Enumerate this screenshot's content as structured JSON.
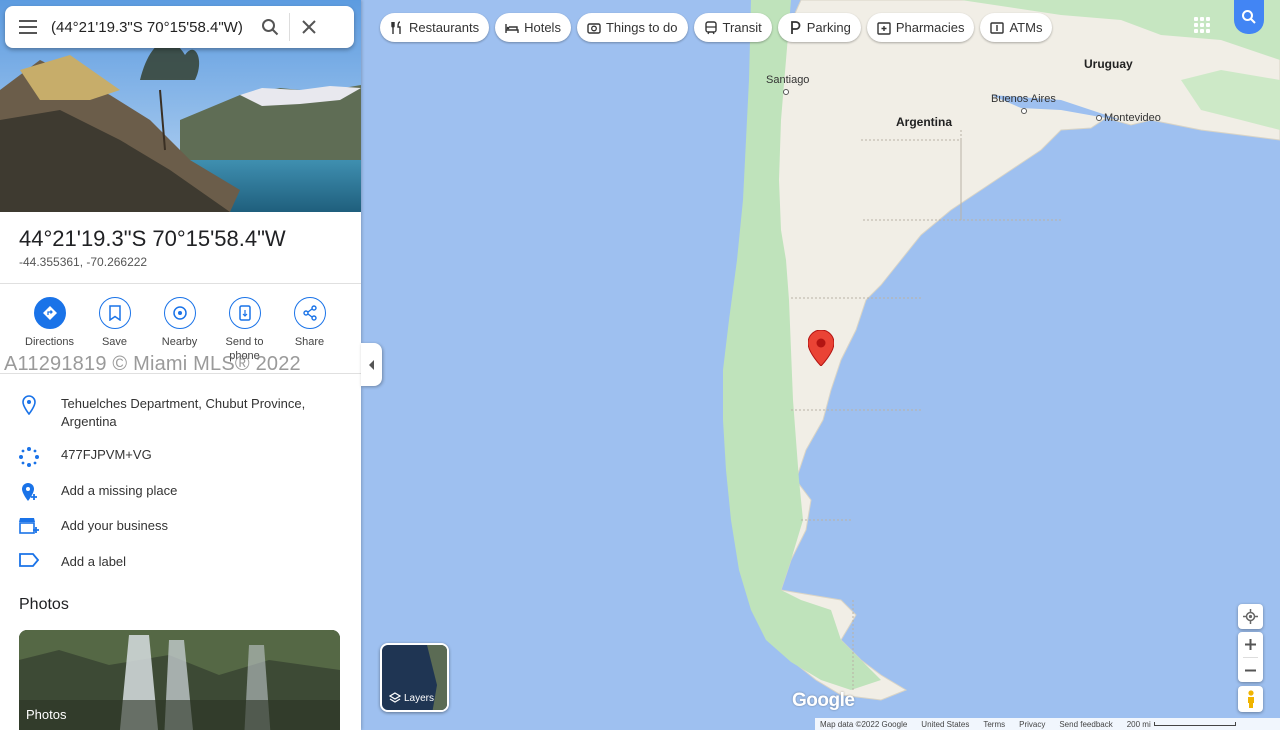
{
  "search": {
    "value": "(44°21'19.3\"S 70°15'58.4\"W)"
  },
  "place": {
    "title": "44°21'19.3\"S 70°15'58.4\"W",
    "decimal": "-44.355361, -70.266222"
  },
  "actions": [
    {
      "label": "Directions",
      "icon": "directions-icon"
    },
    {
      "label": "Save",
      "icon": "bookmark-icon"
    },
    {
      "label": "Nearby",
      "icon": "nearby-icon"
    },
    {
      "label": "Send to phone",
      "icon": "phone-icon"
    },
    {
      "label": "Share",
      "icon": "share-icon"
    }
  ],
  "watermark": "A11291819 © Miami MLS® 2022",
  "info": {
    "address": "Tehuelches Department, Chubut Province, Argentina",
    "pluscode": "477FJPVM+VG",
    "add_place": "Add a missing place",
    "add_business": "Add your business",
    "add_label": "Add a label"
  },
  "photos": {
    "heading": "Photos",
    "card_label": "Photos"
  },
  "chips": [
    {
      "label": "Restaurants",
      "icon": "fork-knife-icon"
    },
    {
      "label": "Hotels",
      "icon": "bed-icon"
    },
    {
      "label": "Things to do",
      "icon": "camera-icon"
    },
    {
      "label": "Transit",
      "icon": "train-icon"
    },
    {
      "label": "Parking",
      "icon": "parking-icon"
    },
    {
      "label": "Pharmacies",
      "icon": "pharmacy-icon"
    },
    {
      "label": "ATMs",
      "icon": "atm-icon"
    }
  ],
  "map_labels": {
    "santiago": "Santiago",
    "argentina": "Argentina",
    "uruguay": "Uruguay",
    "buenos_aires": "Buenos Aires",
    "montevideo": "Montevideo"
  },
  "layers_label": "Layers",
  "footer": {
    "map_data": "Map data ©2022 Google",
    "region": "United States",
    "terms": "Terms",
    "privacy": "Privacy",
    "feedback": "Send feedback",
    "scale": "200 mi"
  },
  "logo": "Google",
  "colors": {
    "accent": "#1a73e8",
    "pin": "#ea4335",
    "water": "#9ec0f0",
    "land": "#f2efe7",
    "forest": "#b9e0b5"
  }
}
